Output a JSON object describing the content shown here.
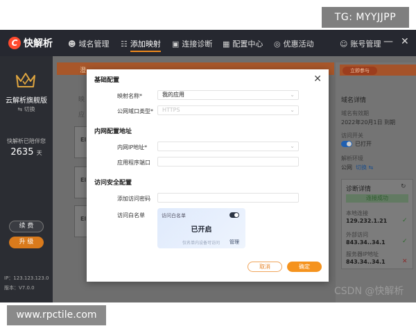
{
  "watermarks": {
    "tg": "TG: MYYJJPP",
    "site": "www.rpctile.com",
    "csdn": "CSDN @快解析"
  },
  "app": {
    "logo_text": "快解析",
    "logo_mark": "C"
  },
  "nav": [
    {
      "label": "域名管理",
      "icon": "user-icon"
    },
    {
      "label": "添加映射",
      "icon": "network-icon"
    },
    {
      "label": "连接诊断",
      "icon": "diagnose-icon"
    },
    {
      "label": "配置中心",
      "icon": "grid-icon"
    },
    {
      "label": "优惠活动",
      "icon": "target-icon"
    },
    {
      "label": "账号管理",
      "icon": "account-icon"
    }
  ],
  "window": {
    "minimize": "—",
    "close": "✕"
  },
  "sidebar": {
    "edition": "云解析旗舰版",
    "switch": "⇆ 切换",
    "days_label": "快解析已陪伴您",
    "days_value": "2635",
    "days_unit": "天",
    "renew": "续 费",
    "upgrade": "升 级",
    "ip": "IP：123.123.123.0",
    "version": "版本：V7.0.0"
  },
  "main": {
    "banner_text": "澄",
    "ghost_labels": [
      "映",
      "应"
    ],
    "ghost_cards": [
      "El",
      "El",
      "El"
    ]
  },
  "right": {
    "ref_button": "立即参与",
    "title": "域名详情",
    "validity_label": "域名有效期",
    "validity_value": "2022年20月1日 到期",
    "access_label": "访问开关",
    "access_value": "已打开",
    "env_label": "解析环境",
    "env_value": "公网",
    "env_switch": "切换 ⇆",
    "diag_title": "诊断详情",
    "diag_status": "连接成功",
    "local_label": "本地连接",
    "local_value": "129.232.1.21",
    "external_label": "外部访问",
    "external_value": "843.34..34.1",
    "server_label": "服务器IP地址",
    "server_value": "843.34..34.1",
    "check": "✓",
    "cross": "✕"
  },
  "modal": {
    "close": "✕",
    "section_basic": "基础配置",
    "mapping_name_label": "映射名称*",
    "mapping_name_value": "我的应用",
    "domain_type_label": "公网域口类型*",
    "domain_type_value": "HTTPS",
    "section_lan": "内网配置地址",
    "lan_ip_label": "内网IP地址*",
    "lan_ip_value": "",
    "app_port_label": "应用程序端口",
    "app_port_value": "",
    "section_security": "访问安全配置",
    "access_pwd_label": "添加访问密码",
    "access_pwd_value": "",
    "whitelist_label": "访问白名单",
    "whitelist_card_title": "访问白名单",
    "whitelist_state": "已开启",
    "whitelist_hint": "仅名单内设备可访问",
    "whitelist_manage": "管理",
    "cancel": "取消",
    "confirm": "确定"
  }
}
